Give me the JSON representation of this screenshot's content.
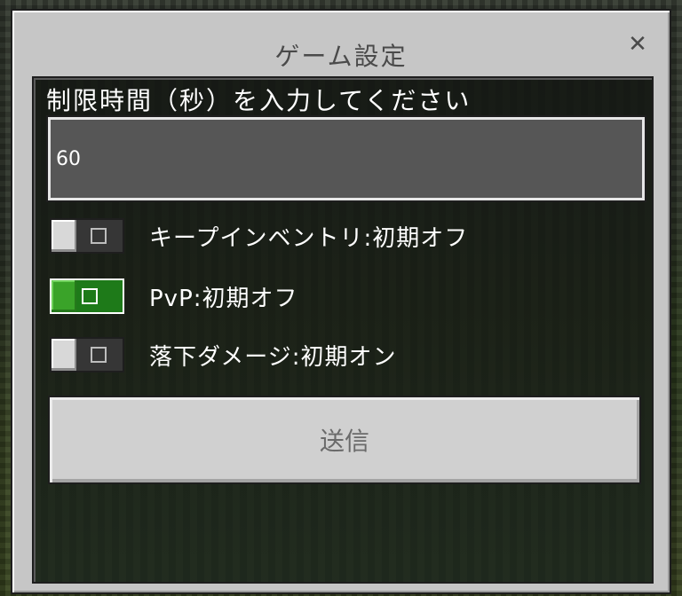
{
  "dialog": {
    "title": "ゲーム設定",
    "close_glyph": "✕"
  },
  "form": {
    "prompt": "制限時間（秒）を入力してください",
    "time_value": "60",
    "toggles": [
      {
        "label": "キープインベントリ:初期オフ",
        "state": "off"
      },
      {
        "label": "PvP:初期オフ",
        "state": "on"
      },
      {
        "label": "落下ダメージ:初期オン",
        "state": "off"
      }
    ],
    "submit_label": "送信"
  },
  "colors": {
    "toggle_on": "#3aa329",
    "panel_text": "#ffffff",
    "dialog_bg": "#c6c6c6"
  }
}
